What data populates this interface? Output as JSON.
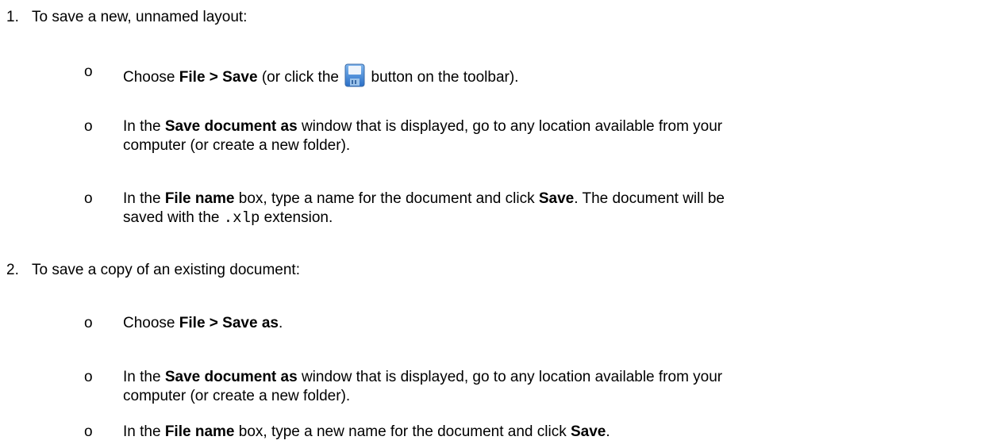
{
  "steps": [
    {
      "number": "1.",
      "text": "To save a new, unnamed layout:",
      "bullets": [
        {
          "marker": "o",
          "a": "Choose ",
          "b1": "File > Save",
          "c": " (or click the ",
          "icon": "floppy-disk-save-icon",
          "d": " button on the toolbar)."
        },
        {
          "marker": "o",
          "a": "In the ",
          "b1": "Save document as",
          "c": " window that is displayed, go to any location available from your",
          "line2": "computer (or create a new folder)."
        },
        {
          "marker": "o",
          "a": "In the ",
          "b1": "File name",
          "c": " box, type a name for the document and click ",
          "b2": "Save",
          "d": ". The document will be",
          "line2a": "saved with the ",
          "line2code": ".xlp",
          "line2b": " extension."
        }
      ]
    },
    {
      "number": "2.",
      "text": "To save a copy of an existing document:",
      "bullets": [
        {
          "marker": "o",
          "a": "Choose ",
          "b1": "File > Save as",
          "c": "."
        },
        {
          "marker": "o",
          "a": "In the ",
          "b1": "Save document as",
          "c": " window that is displayed, go to any location available from your",
          "line2": "computer (or create a new folder)."
        },
        {
          "marker": "o",
          "a": "In the ",
          "b1": "File name",
          "c": " box, type a new name for the document and click ",
          "b2": "Save",
          "d": "."
        }
      ]
    }
  ]
}
